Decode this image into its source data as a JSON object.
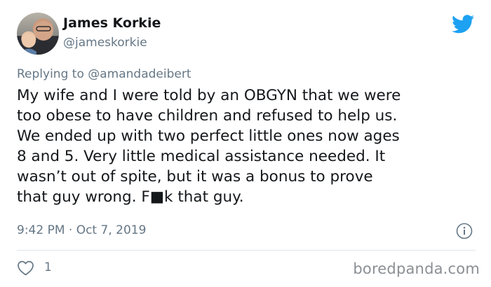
{
  "author": {
    "display_name": "James Korkie",
    "handle": "@jameskorkie"
  },
  "reply": {
    "prefix": "Replying to",
    "mention": "@amandadeibert"
  },
  "tweet": {
    "text": "My wife and I were told by an OBGYN that we were\ntoo obese to have children and refused to help us.\nWe ended up with two perfect little ones now ages\n8 and 5. Very little medical assistance needed. It\nwasn’t out of spite, but it was a bonus to prove\nthat guy wrong. F■k that guy.",
    "timestamp": "9:42 PM · Oct 7, 2019"
  },
  "actions": {
    "like_count": "1"
  },
  "watermark": "boredpanda.com",
  "icons": {
    "brand": "twitter-bird-icon",
    "info": "info-icon",
    "like": "heart-icon"
  },
  "colors": {
    "twitter_blue": "#1da1f2",
    "secondary_text": "#657786",
    "primary_text": "#14171a"
  }
}
